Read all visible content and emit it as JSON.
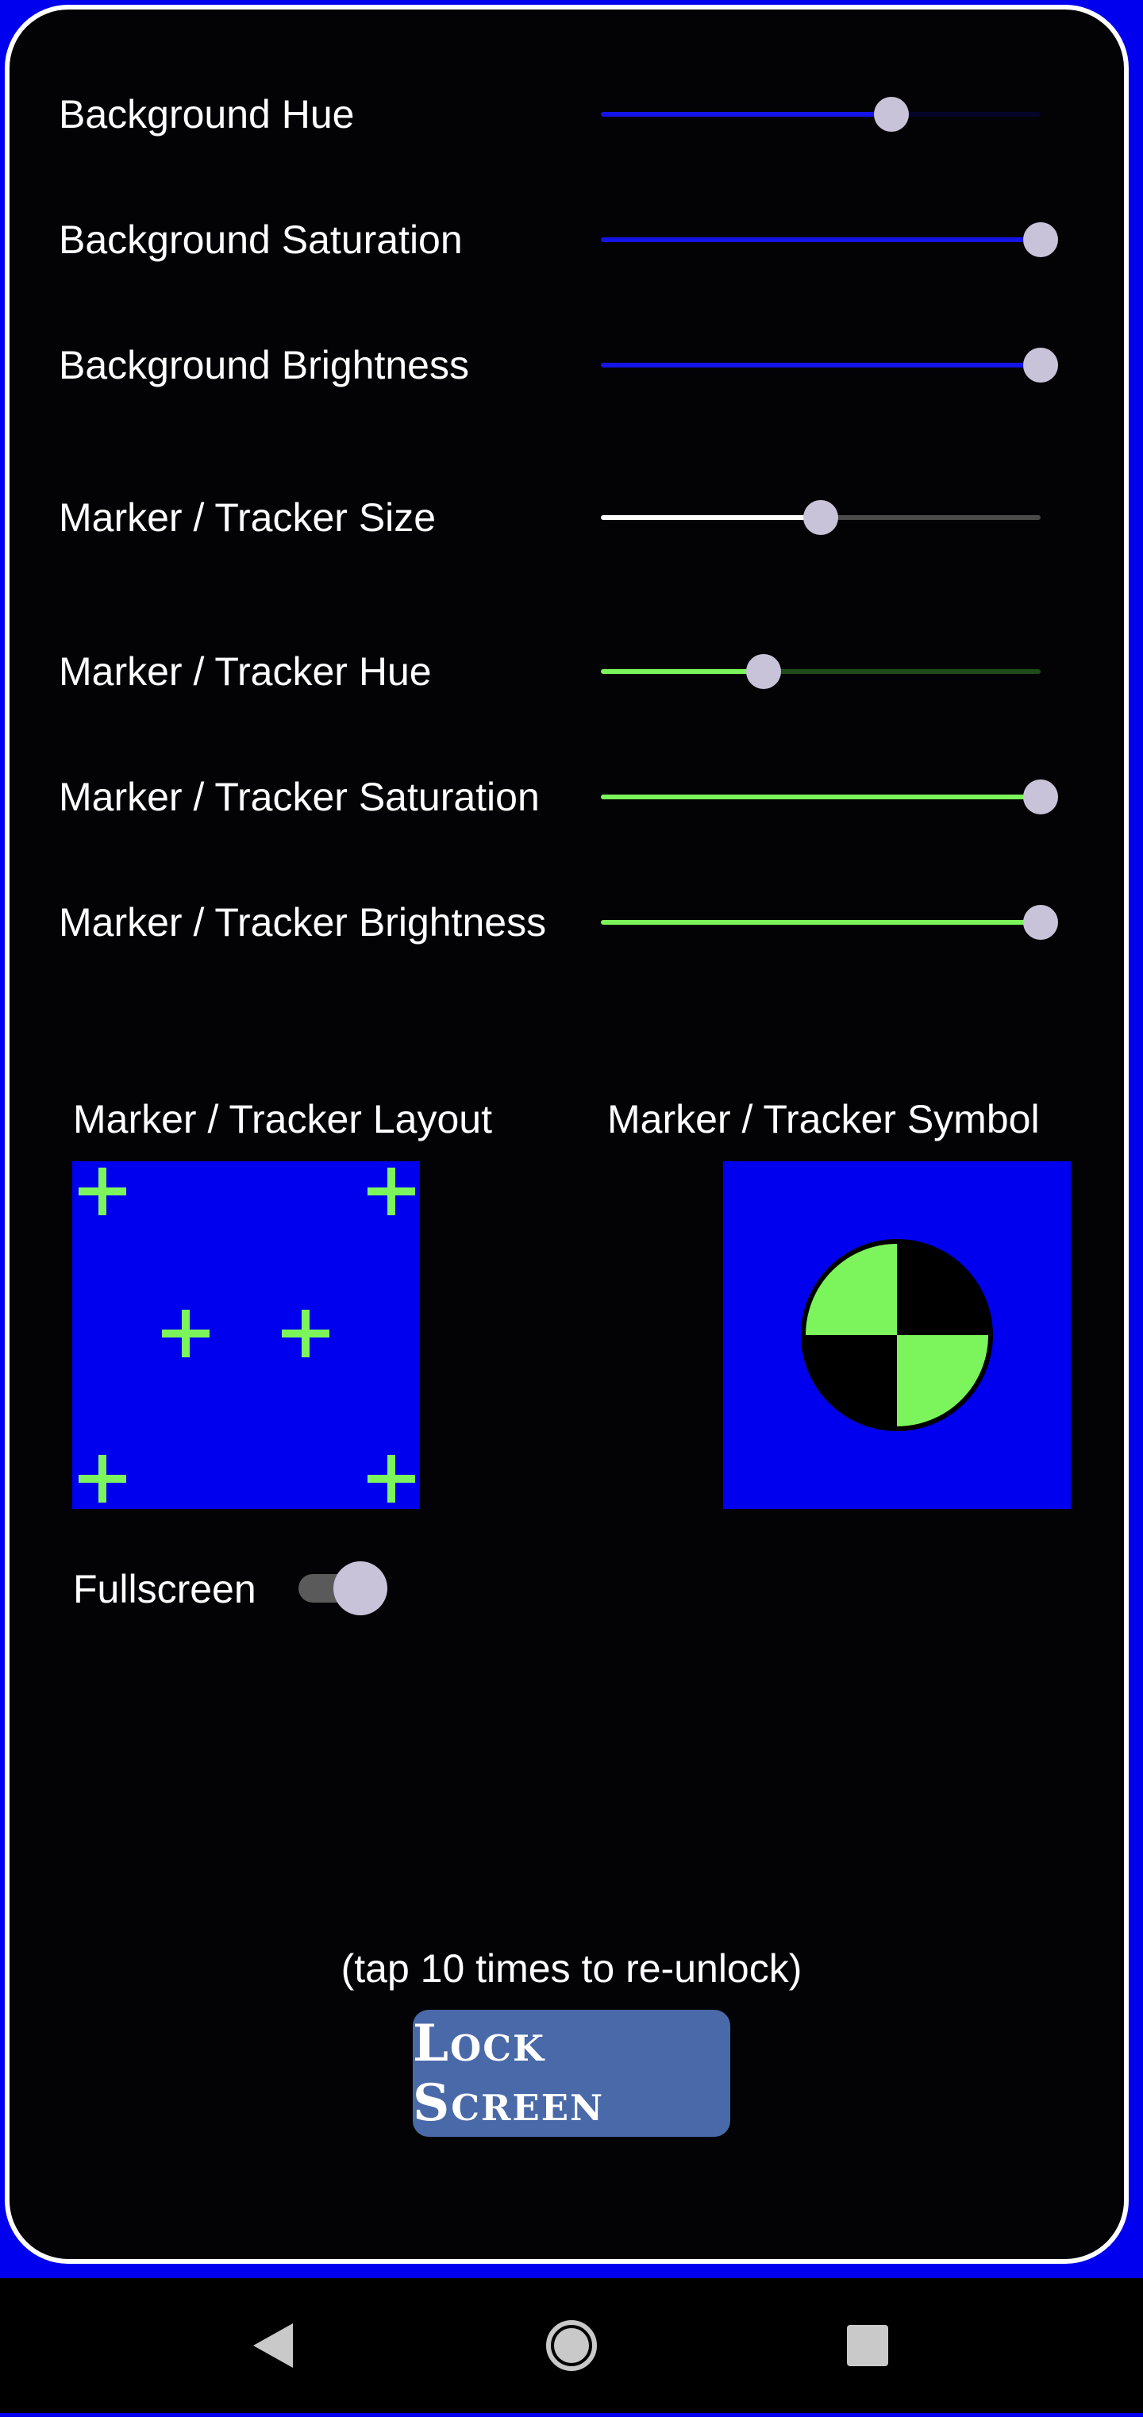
{
  "sliders": [
    {
      "label": "Background Hue",
      "value": 0.66,
      "fill": "#1414e6",
      "rest": "#05052a"
    },
    {
      "label": "Background Saturation",
      "value": 1.0,
      "fill": "#1414e6",
      "rest": "#05052a"
    },
    {
      "label": "Background Brightness",
      "value": 1.0,
      "fill": "#1414e6",
      "rest": "#05052a"
    },
    {
      "label": "Marker / Tracker Size",
      "value": 0.5,
      "fill": "#ffffff",
      "rest": "#4a4a4a"
    },
    {
      "label": "Marker / Tracker Hue",
      "value": 0.37,
      "fill": "#7cf55c",
      "rest": "#1f4a1a"
    },
    {
      "label": "Marker / Tracker Saturation",
      "value": 1.0,
      "fill": "#7cf55c",
      "rest": "#1f4a1a"
    },
    {
      "label": "Marker / Tracker Brightness",
      "value": 1.0,
      "fill": "#7cf55c",
      "rest": "#1f4a1a"
    }
  ],
  "layout": {
    "label": "Marker / Tracker Layout"
  },
  "symbol": {
    "label": "Marker / Tracker Symbol"
  },
  "fullscreen": {
    "label": "Fullscreen",
    "on": true
  },
  "lock": {
    "hint": "(tap 10 times to re-unlock)",
    "button_label": "Lock Screen"
  },
  "colors": {
    "background": "#0000ee",
    "marker": "#7cf55c",
    "panel": "#030305"
  },
  "nav": {
    "back_icon": "back-triangle-icon",
    "home_icon": "home-circle-icon",
    "recents_icon": "recents-square-icon"
  }
}
